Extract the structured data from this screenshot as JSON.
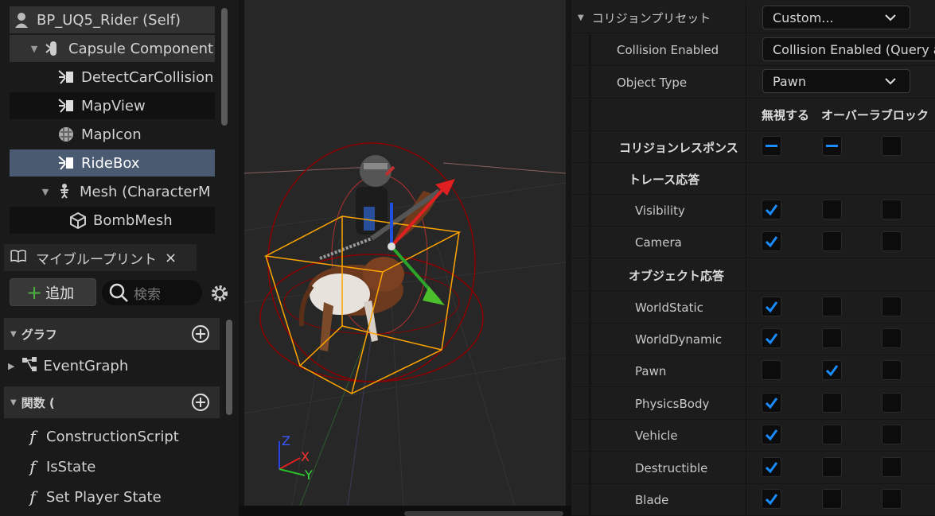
{
  "components": {
    "root": "BP_UQ5_Rider (Self)",
    "items": [
      {
        "label": "Capsule Component"
      },
      {
        "label": "DetectCarCollision"
      },
      {
        "label": "MapView"
      },
      {
        "label": "MapIcon"
      },
      {
        "label": "RideBox"
      },
      {
        "label": "Mesh (CharacterM"
      },
      {
        "label": "BombMesh"
      }
    ]
  },
  "my_blueprint": {
    "tab_label": "マイブループリント",
    "close_glyph": "×",
    "add_label": "追加",
    "add_glyph": "+",
    "search_placeholder": "検索",
    "graph_category": "グラフ",
    "event_graph": "EventGraph",
    "functions_category": "関数 (",
    "functions": [
      "ConstructionScript",
      "IsState",
      "Set Player State"
    ],
    "function_glyph": "f"
  },
  "viewport": {
    "axis_labels": {
      "z": "Z",
      "x": "X",
      "y": "Y"
    }
  },
  "details": {
    "preset_label": "コリジョンプリセット",
    "preset_value": "Custom...",
    "collision_enabled_label": "Collision Enabled",
    "collision_enabled_value": "Collision Enabled (Query an",
    "object_type_label": "Object Type",
    "object_type_value": "Pawn",
    "col_ignore": "無視する",
    "col_overlap_block": "オーバーラブロック",
    "response_label": "コリジョンレスポンス",
    "trace_label": "トレース応答",
    "object_label": "オブジェクト応答",
    "responses": [
      {
        "name": "Visibility",
        "state": 0
      },
      {
        "name": "Camera",
        "state": 0
      },
      {
        "name": "WorldStatic",
        "state": 0
      },
      {
        "name": "WorldDynamic",
        "state": 0
      },
      {
        "name": "Pawn",
        "state": 1
      },
      {
        "name": "PhysicsBody",
        "state": 0
      },
      {
        "name": "Vehicle",
        "state": 0
      },
      {
        "name": "Destructible",
        "state": 0
      },
      {
        "name": "Blade",
        "state": 0
      }
    ],
    "accent_color": "#1a8cff"
  }
}
